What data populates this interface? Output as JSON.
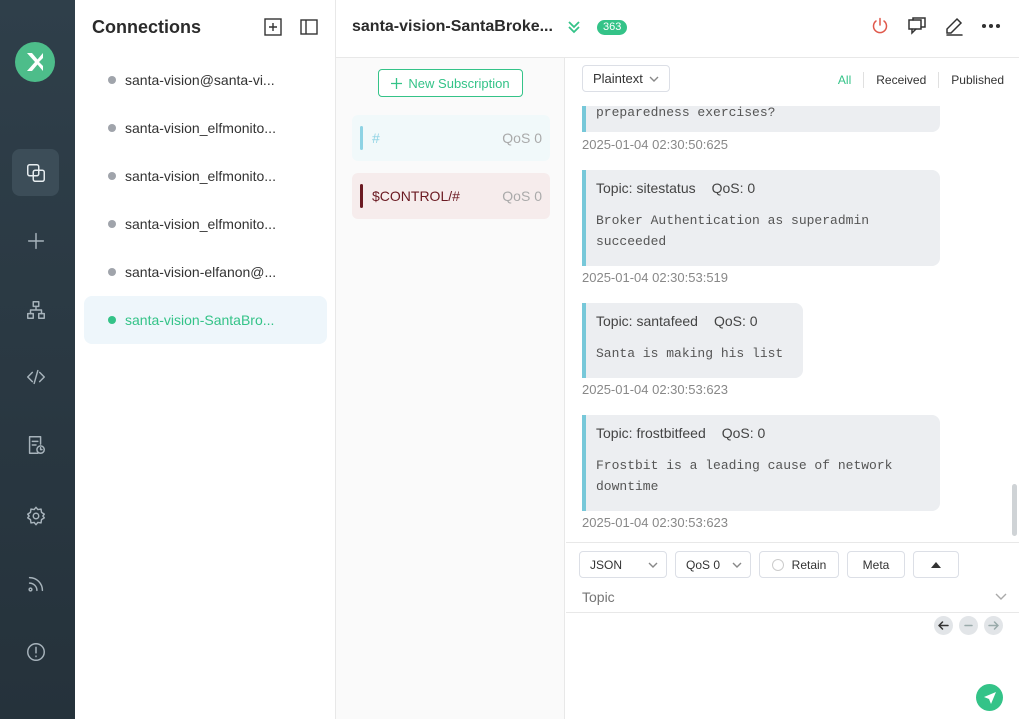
{
  "sidebar": {
    "icons": [
      "connections-icon",
      "add-icon",
      "topology-icon",
      "script-icon",
      "log-icon",
      "settings-icon",
      "feed-icon",
      "about-icon"
    ]
  },
  "connections": {
    "title": "Connections",
    "items": [
      {
        "label": "santa-vision@santa-vi..."
      },
      {
        "label": "santa-vision_elfmonito..."
      },
      {
        "label": "santa-vision_elfmonito..."
      },
      {
        "label": "santa-vision_elfmonito..."
      },
      {
        "label": "santa-vision-elfanon@..."
      },
      {
        "label": "santa-vision-SantaBro..."
      }
    ]
  },
  "header": {
    "title": "santa-vision-SantaBroke...",
    "count": "363"
  },
  "subscriptions": {
    "new_label": "New Subscription",
    "items": [
      {
        "topic": "#",
        "qos": "QoS 0",
        "color": "#8ed3e4"
      },
      {
        "topic": "$CONTROL/#",
        "qos": "QoS 0",
        "color": "#6b1a22"
      }
    ]
  },
  "messages": {
    "format": "Plaintext",
    "filters": {
      "all": "All",
      "received": "Received",
      "published": "Published"
    },
    "list": [
      {
        "payload": "preparedness exercises?",
        "time": "2025-01-04 02:30:50:625"
      },
      {
        "topic": "Topic: sitestatus",
        "qos": "QoS: 0",
        "payload_1": "Broker Authentication as superadmin",
        "payload_2": "succeeded",
        "time": "2025-01-04 02:30:53:519"
      },
      {
        "topic": "Topic: santafeed",
        "qos": "QoS: 0",
        "payload_1": "Santa is making his list",
        "time": "2025-01-04 02:30:53:623"
      },
      {
        "topic": "Topic: frostbitfeed",
        "qos": "QoS: 0",
        "payload_1": "Frostbit is a leading cause of network",
        "payload_2": "downtime",
        "time": "2025-01-04 02:30:53:623"
      }
    ]
  },
  "publish": {
    "format": "JSON",
    "qos": "QoS 0",
    "retain": "Retain",
    "meta": "Meta",
    "topic_placeholder": "Topic"
  },
  "colors": {
    "accent": "#34c388",
    "rail": "#2f3f4a",
    "danger": "#e0584b"
  }
}
